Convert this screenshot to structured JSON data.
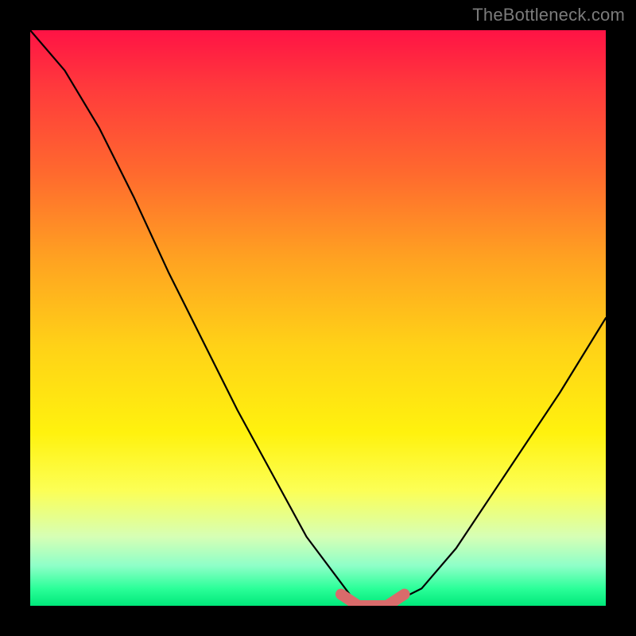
{
  "watermark": "TheBottleneck.com",
  "chart_data": {
    "type": "line",
    "title": "",
    "xlabel": "",
    "ylabel": "",
    "xlim": [
      0,
      100
    ],
    "ylim": [
      0,
      100
    ],
    "x": [
      0,
      6,
      12,
      18,
      24,
      30,
      36,
      42,
      48,
      54,
      57,
      62,
      68,
      74,
      80,
      86,
      92,
      100
    ],
    "values": [
      100,
      93,
      83,
      71,
      58,
      46,
      34,
      23,
      12,
      4,
      0,
      0,
      3,
      10,
      19,
      28,
      37,
      50
    ],
    "series": [
      {
        "name": "bottleneck-curve",
        "x": [
          0,
          6,
          12,
          18,
          24,
          30,
          36,
          42,
          48,
          54,
          57,
          62,
          68,
          74,
          80,
          86,
          92,
          100
        ],
        "values": [
          100,
          93,
          83,
          71,
          58,
          46,
          34,
          23,
          12,
          4,
          0,
          0,
          3,
          10,
          19,
          28,
          37,
          50
        ]
      },
      {
        "name": "optimal-zone-marker",
        "x": [
          54,
          57,
          62,
          65
        ],
        "values": [
          2,
          0,
          0,
          2
        ]
      }
    ],
    "colors": {
      "curve": "#000000",
      "marker": "#d96b6b",
      "gradient_top": "#ff1345",
      "gradient_bottom": "#00e87a"
    }
  }
}
